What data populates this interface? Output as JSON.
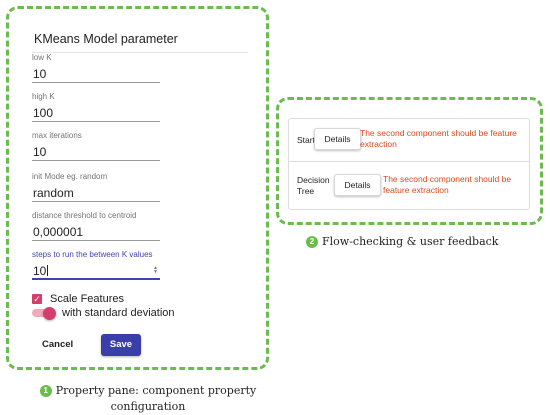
{
  "property_pane": {
    "title": "KMeans Model parameter",
    "fields": [
      {
        "label": "low K",
        "value": "10"
      },
      {
        "label": "high K",
        "value": "100"
      },
      {
        "label": "max iterations",
        "value": "10"
      },
      {
        "label": "init Mode eg. random",
        "value": "random"
      },
      {
        "label": "distance threshold to centroid",
        "value": "0,000001"
      },
      {
        "label": "steps to run the between K values",
        "value": "10",
        "active": true
      }
    ],
    "scale_features": {
      "label": "Scale Features",
      "checked": true
    },
    "standard_deviation": {
      "label": "with standard deviation",
      "on": true
    },
    "cancel_label": "Cancel",
    "save_label": "Save",
    "accent_color": "#3a3ea8",
    "toggle_color": "#d43e6a"
  },
  "flow_check": {
    "rows": [
      {
        "name": "Start",
        "button": "Details",
        "message": "The second component should be feature extraction"
      },
      {
        "name": "Decision Tree",
        "button": "Details",
        "message": "The second component should be feature extraction"
      }
    ],
    "message_color": "#d64a1e"
  },
  "captions": {
    "flow": {
      "number": "2",
      "text": "Flow-checking & user feedback"
    },
    "pane": {
      "number": "1",
      "text": "Property pane: component property configuration"
    }
  },
  "frame_color": "#6cbb4f"
}
